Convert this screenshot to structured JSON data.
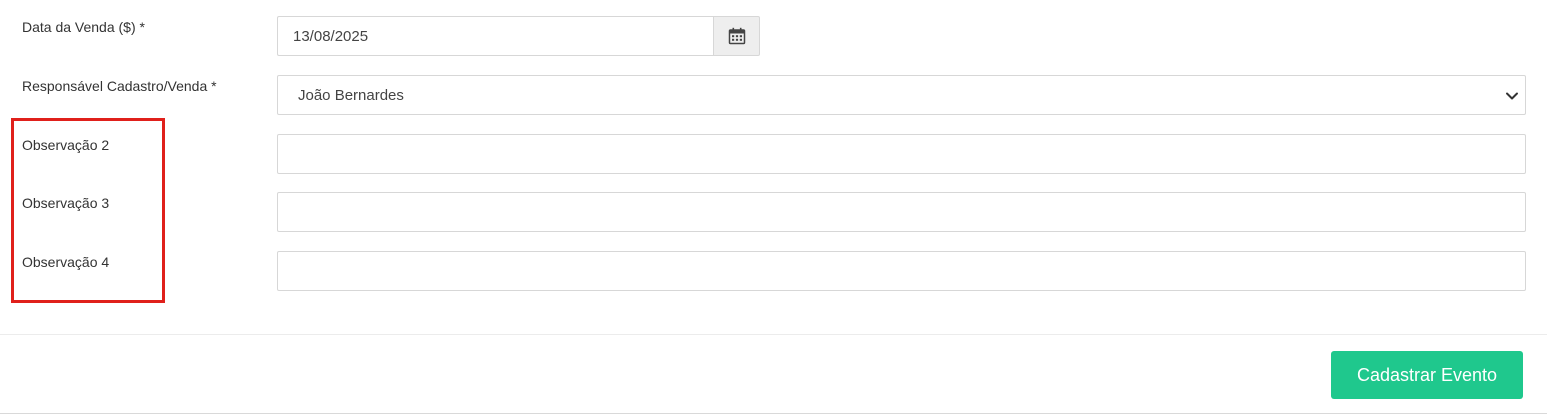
{
  "form": {
    "sale_date": {
      "label": "Data da Venda ($) *",
      "value": "13/08/2025",
      "addon_icon": "calendar-icon"
    },
    "responsible": {
      "label": "Responsável Cadastro/Venda *",
      "selected": "João Bernardes",
      "icon": "chevron-down-icon"
    },
    "observations": [
      {
        "label": "Observação 2",
        "value": ""
      },
      {
        "label": "Observação 3",
        "value": ""
      },
      {
        "label": "Observação 4",
        "value": ""
      }
    ]
  },
  "annotation": {
    "highlight_color": "#e0201b"
  },
  "footer": {
    "submit_label": "Cadastrar Evento",
    "submit_color": "#1fc88d"
  }
}
